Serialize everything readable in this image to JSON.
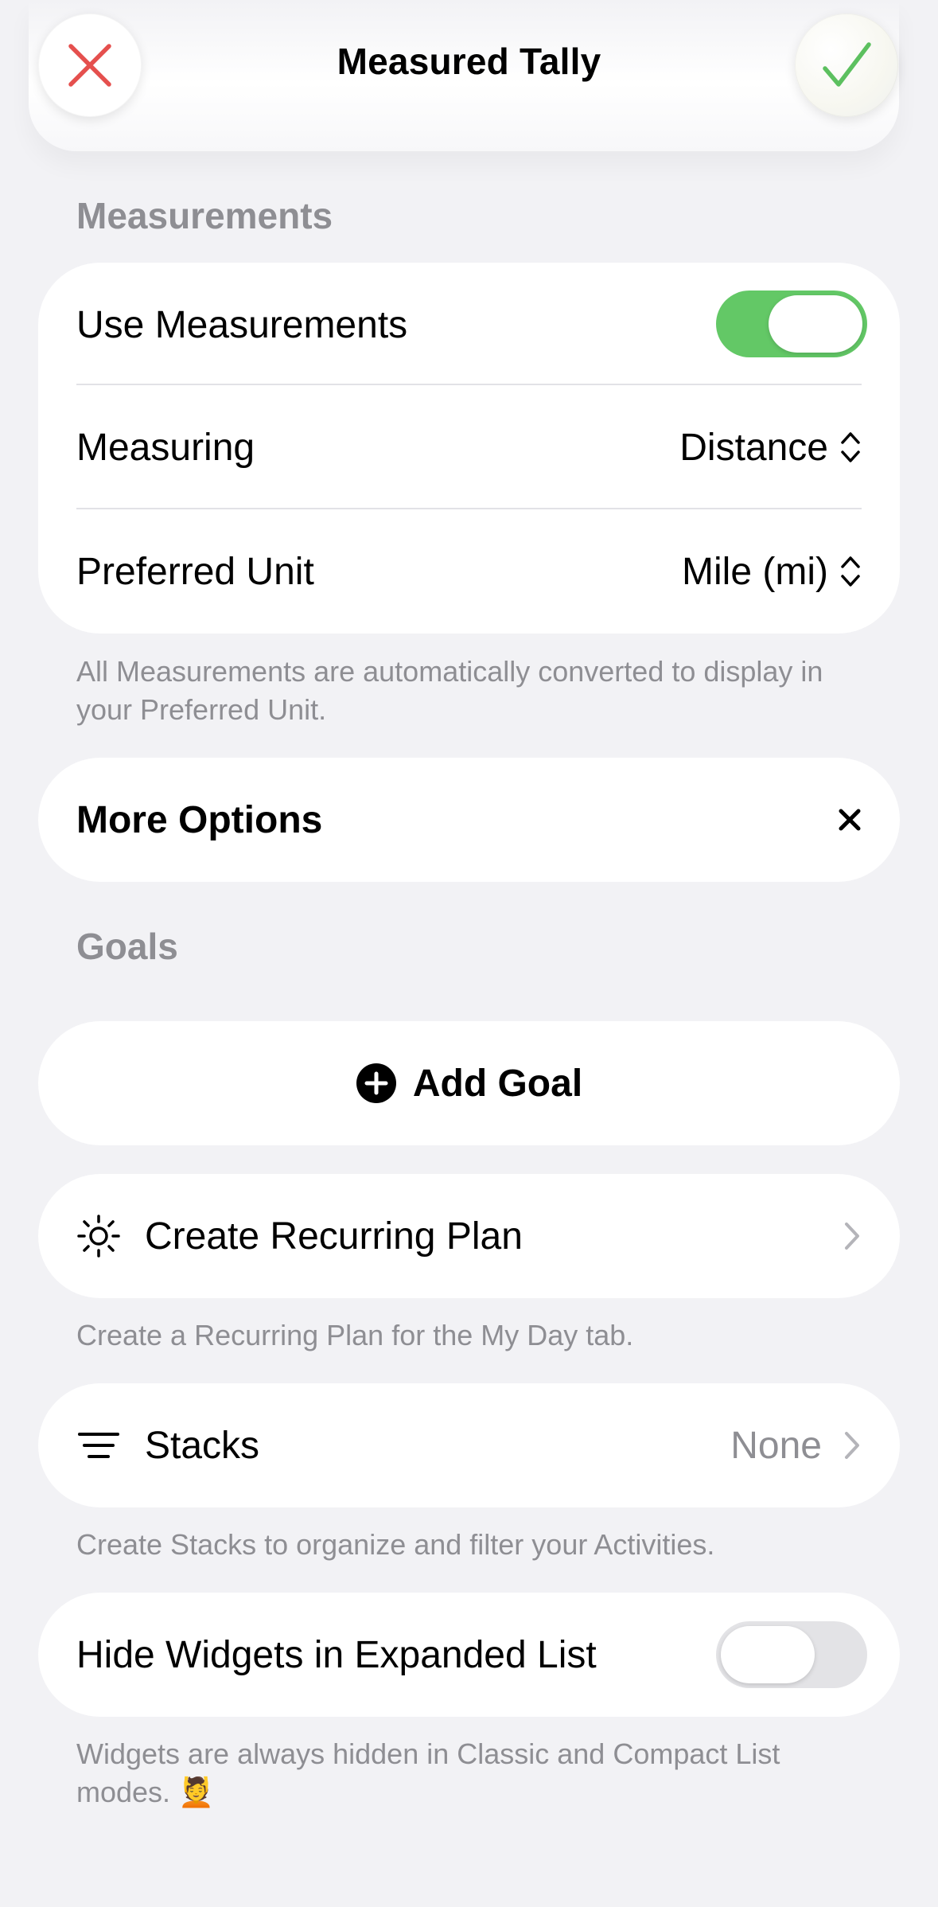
{
  "header": {
    "title": "Measured Tally",
    "cancel_icon": "close-icon",
    "confirm_icon": "checkmark-icon",
    "cancel_color": "#e5504e",
    "confirm_color": "#5cc05f"
  },
  "measurements": {
    "section_label": "Measurements",
    "use_measurements_label": "Use Measurements",
    "use_measurements_on": true,
    "measuring_label": "Measuring",
    "measuring_value": "Distance",
    "preferred_unit_label": "Preferred Unit",
    "preferred_unit_value": "Mile (mi)",
    "footnote": "All Measurements are automatically converted to display in your Preferred Unit."
  },
  "more_options": {
    "label": "More Options",
    "close_icon": "close-icon"
  },
  "goals": {
    "section_label": "Goals",
    "add_goal_label": "Add Goal",
    "add_goal_icon": "plus-circle-icon"
  },
  "recurring_plan": {
    "label": "Create Recurring Plan",
    "icon": "sun-icon",
    "footnote": "Create a Recurring Plan for the My Day tab."
  },
  "stacks": {
    "label": "Stacks",
    "icon": "lines-icon",
    "value": "None",
    "footnote": "Create Stacks to organize and filter your Activities."
  },
  "hide_widgets": {
    "label": "Hide Widgets in Expanded List",
    "on": false,
    "footnote": "Widgets are always hidden in Classic and Compact List modes. 💆"
  },
  "colors": {
    "toggle_on": "#63c866",
    "toggle_off": "#e3e3e6",
    "secondary_text": "#8e8e93",
    "background": "#f2f2f5"
  }
}
